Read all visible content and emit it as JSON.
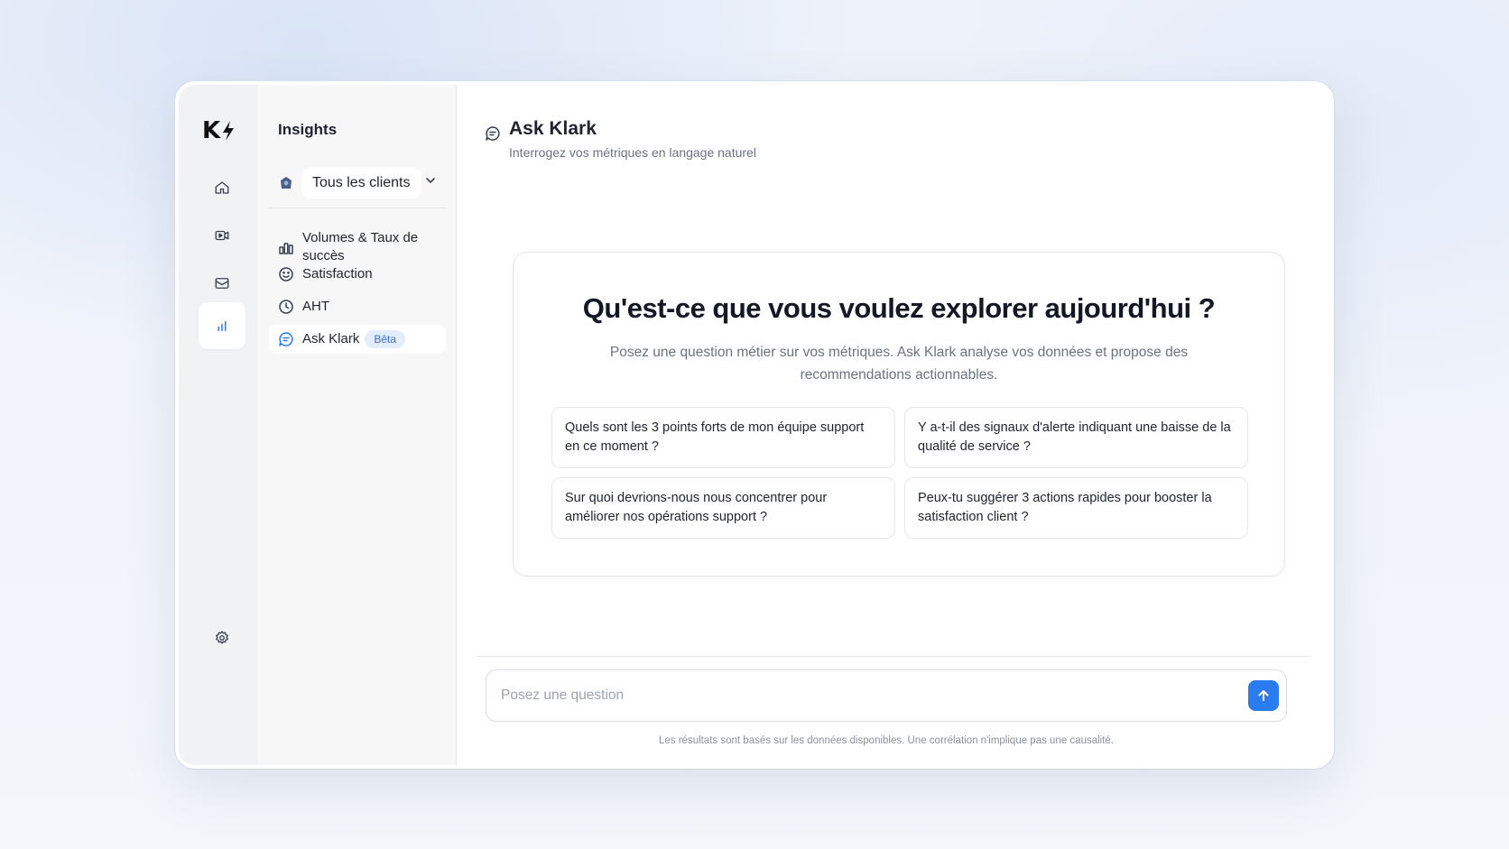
{
  "rail": {
    "logo": "K",
    "items": [
      {
        "icon": "home-icon",
        "active": false
      },
      {
        "icon": "video-icon",
        "active": false
      },
      {
        "icon": "inbox-icon",
        "active": false
      },
      {
        "icon": "bar-chart-icon",
        "active": true
      }
    ],
    "bottom_icon": "gear-icon"
  },
  "nav": {
    "title": "Insights",
    "client_select": {
      "value": "Tous les clients"
    },
    "items": [
      {
        "label": "Volumes & Taux de succès",
        "icon": "bar-chart-icon"
      },
      {
        "label": "Satisfaction",
        "icon": "smile-icon"
      },
      {
        "label": "AHT",
        "icon": "clock-icon"
      },
      {
        "label": "Ask Klark",
        "icon": "chat-icon",
        "badge": "Bêta",
        "active": true
      }
    ]
  },
  "main": {
    "title": "Ask Klark",
    "subtitle": "Interrogez vos métriques en langage naturel",
    "card": {
      "title": "Qu'est-ce que vous voulez explorer aujourd'hui ?",
      "description": "Posez une question métier sur vos métriques. Ask Klark analyse vos données et propose des recommendations actionnables.",
      "suggestions": [
        "Quels sont les 3 points forts de mon équipe support en ce moment ?",
        "Y a-t-il des signaux d'alerte indiquant une baisse de la qualité de service ?",
        "Sur quoi devrions-nous nous concentrer pour améliorer nos opérations support ?",
        "Peux-tu suggérer 3 actions rapides pour booster la satisfaction client ?"
      ]
    },
    "composer": {
      "placeholder": "Posez une question",
      "value": ""
    },
    "disclaimer": "Les résultats sont basés sur les données disponibles. Une corrélation n'implique pas une causalité."
  },
  "colors": {
    "accent": "#2b7cf0",
    "beta_bg": "#e3edfc",
    "beta_text": "#3b6fd1"
  }
}
